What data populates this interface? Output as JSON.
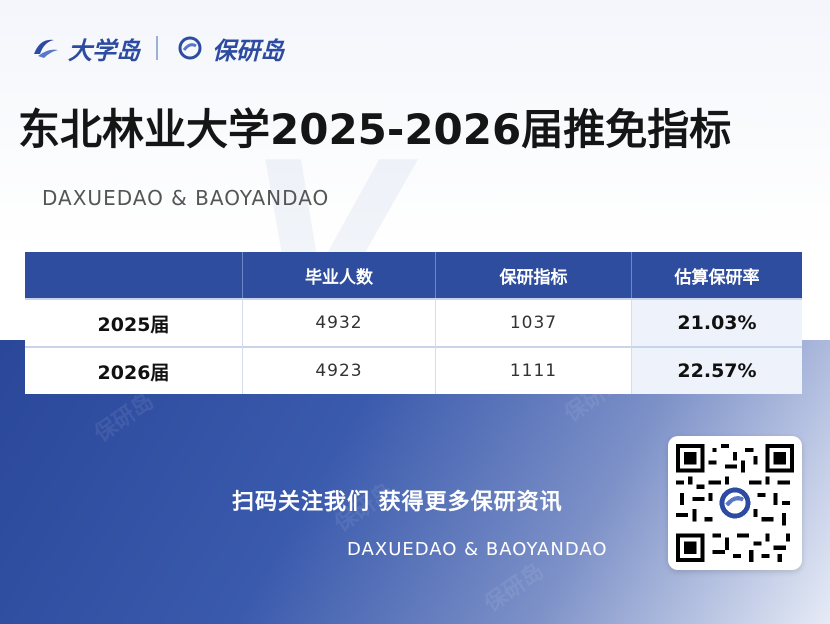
{
  "brand": {
    "logo1_text": "大学岛",
    "logo2_text": "保研岛"
  },
  "title": "东北林业大学2025-2026届推免指标",
  "subtitle": "DAXUEDAO & BAOYANDAO",
  "table": {
    "headers": [
      "",
      "毕业人数",
      "保研指标",
      "估算保研率"
    ],
    "rows": [
      {
        "year": "2025届",
        "graduates": "4932",
        "quota": "1037",
        "rate": "21.03%"
      },
      {
        "year": "2026届",
        "graduates": "4923",
        "quota": "1111",
        "rate": "22.57%"
      }
    ]
  },
  "footer": {
    "cta": "扫码关注我们 获得更多保研资讯",
    "sub": "DAXUEDAO & BAOYANDAO"
  },
  "watermark_text": "保研岛",
  "colors": {
    "brand_blue": "#2f4d9e",
    "title_text": "#151515"
  },
  "icons": [
    "daxuedao-logo-icon",
    "baoyandao-logo-icon",
    "qr-code"
  ]
}
